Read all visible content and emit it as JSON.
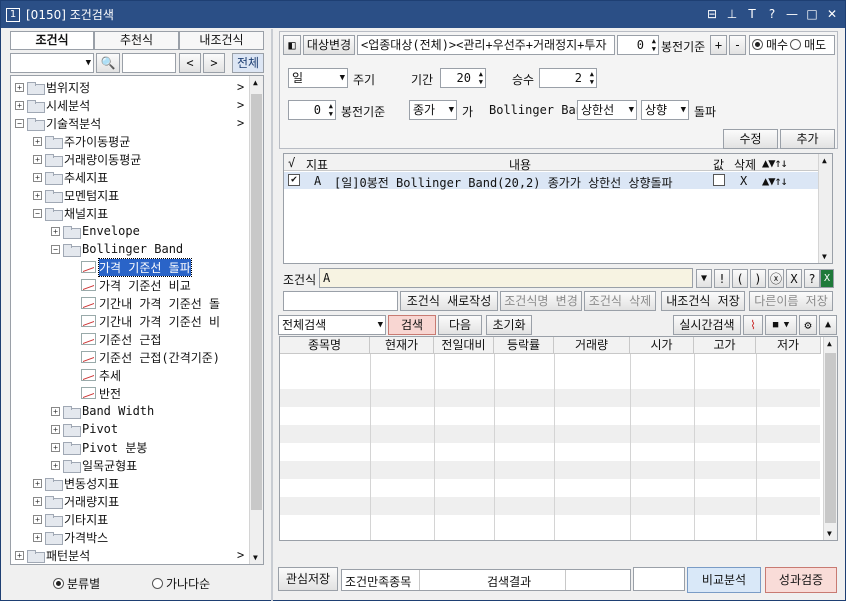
{
  "window": {
    "number": "1",
    "title": "[0150] 조건검색"
  },
  "title_controls": [
    "⊟",
    "⊥",
    "T",
    "?",
    "—",
    "□",
    "✕"
  ],
  "left": {
    "tabs": [
      "조건식",
      "추천식",
      "내조건식"
    ],
    "search": {
      "prev": "<",
      "next": ">",
      "all": "전체"
    },
    "tree": [
      {
        "label": "범위지정",
        "level": 0,
        "type": "folder",
        "expanded": false,
        "arrow": ">"
      },
      {
        "label": "시세분석",
        "level": 0,
        "type": "folder",
        "expanded": false,
        "arrow": ">"
      },
      {
        "label": "기술적분석",
        "level": 0,
        "type": "folder",
        "expanded": true,
        "arrow": ">"
      },
      {
        "label": "주가이동평균",
        "level": 1,
        "type": "folder",
        "expanded": false
      },
      {
        "label": "거래량이동평균",
        "level": 1,
        "type": "folder",
        "expanded": false
      },
      {
        "label": "추세지표",
        "level": 1,
        "type": "folder",
        "expanded": false
      },
      {
        "label": "모멘텀지표",
        "level": 1,
        "type": "folder",
        "expanded": false
      },
      {
        "label": "채널지표",
        "level": 1,
        "type": "folder",
        "expanded": true
      },
      {
        "label": "Envelope",
        "level": 2,
        "type": "folder",
        "expanded": false
      },
      {
        "label": "Bollinger Band",
        "level": 2,
        "type": "folder",
        "expanded": true
      },
      {
        "label": "가격 기준선 돌파",
        "level": 3,
        "type": "leaf",
        "selected": true
      },
      {
        "label": "가격 기준선 비교",
        "level": 3,
        "type": "leaf"
      },
      {
        "label": "기간내 가격 기준선 돌",
        "level": 3,
        "type": "leaf"
      },
      {
        "label": "기간내 가격 기준선 비",
        "level": 3,
        "type": "leaf"
      },
      {
        "label": "기준선 근접",
        "level": 3,
        "type": "leaf"
      },
      {
        "label": "기준선 근접(간격기준)",
        "level": 3,
        "type": "leaf"
      },
      {
        "label": "추세",
        "level": 3,
        "type": "leaf"
      },
      {
        "label": "반전",
        "level": 3,
        "type": "leaf"
      },
      {
        "label": "Band Width",
        "level": 2,
        "type": "folder",
        "expanded": false
      },
      {
        "label": "Pivot",
        "level": 2,
        "type": "folder",
        "expanded": false
      },
      {
        "label": "Pivot 분봉",
        "level": 2,
        "type": "folder",
        "expanded": false
      },
      {
        "label": "일목균형표",
        "level": 2,
        "type": "folder",
        "expanded": false
      },
      {
        "label": "변동성지표",
        "level": 1,
        "type": "folder",
        "expanded": false
      },
      {
        "label": "거래량지표",
        "level": 1,
        "type": "folder",
        "expanded": false
      },
      {
        "label": "기타지표",
        "level": 1,
        "type": "folder",
        "expanded": false
      },
      {
        "label": "가격박스",
        "level": 1,
        "type": "folder",
        "expanded": false
      },
      {
        "label": "패턴분석",
        "level": 0,
        "type": "folder",
        "expanded": false,
        "arrow": ">"
      }
    ],
    "radio": {
      "category": "분류별",
      "alpha": "가나다순"
    }
  },
  "top": {
    "target_button": "대상변경",
    "target_value": "<업종대상(전체)><관리+우선주+거래정지+투자",
    "bong_value": "0",
    "bong_label": "봉전기준",
    "plus": "+",
    "minus": "-",
    "buy": "매수",
    "sell": "매도"
  },
  "params": {
    "period_select": "일",
    "period_label": "주기",
    "term_label": "기간",
    "term_value": "20",
    "mult_label": "승수",
    "mult_value": "2",
    "bong_value": "0",
    "bong_label": "봉전기준",
    "price_select": "종가",
    "price_suffix": "가",
    "indicator": "Bollinger Band",
    "line_select": "상한선",
    "dir_select": "상향",
    "action": "돌파",
    "modify": "수정",
    "add": "추가"
  },
  "cond_table": {
    "headers": {
      "check": "√",
      "ind": "지표",
      "content": "내용",
      "val": "값",
      "del": "삭제",
      "move": "▲▼↑↓"
    },
    "rows": [
      {
        "check": "✔",
        "ind": "A",
        "content": "[일]0봉전 Bollinger Band(20,2) 종가가 상한선 상향돌파",
        "del": "X",
        "move": "▲▼↑↓"
      }
    ]
  },
  "formula": {
    "label": "조건식",
    "value": "A",
    "ops": [
      "▼",
      "!",
      "(",
      ")",
      "ⓧ",
      "X",
      "?"
    ],
    "new_btn": "조건식 새로작성",
    "rename_btn": "조건식명 변경",
    "delete_btn": "조건식 삭제",
    "save_btn": "내조건식 저장",
    "saveas_btn": "다른이름 저장"
  },
  "search": {
    "select": "전체검색",
    "search_btn": "검색",
    "next_btn": "다음",
    "reset_btn": "초기화",
    "realtime_btn": "실시간검색"
  },
  "results": {
    "headers": [
      "종목명",
      "현재가",
      "전일대비",
      "등락률",
      "거래량",
      "시가",
      "고가",
      "저가"
    ]
  },
  "bottom": {
    "fav_btn": "관심저장",
    "satisfy_label": "조건만족종목",
    "result_label": "검색결과",
    "compare_btn": "비교분석",
    "verify_btn": "성과검증"
  }
}
